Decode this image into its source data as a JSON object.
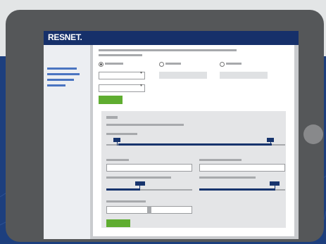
{
  "header": {
    "brand": "RESNET."
  },
  "colors": {
    "header_bg": "#16306a",
    "accent": "#5fad30",
    "slider": "#17346d",
    "nav_link": "#4a74c1",
    "tablet_frame": "#555759"
  },
  "sidebar": {
    "items": [
      "nav-item-1",
      "nav-item-2",
      "nav-item-3",
      "nav-item-4"
    ]
  },
  "form": {
    "radio_options": [
      "option-1",
      "option-2",
      "option-3"
    ],
    "selected_radio": 0,
    "sliders": [
      {
        "name": "range-slider-1",
        "min_fraction": 0.0,
        "max_fraction": 1.0
      },
      {
        "name": "slider-2",
        "value_fraction": 0.4
      },
      {
        "name": "slider-3",
        "value_fraction": 0.98
      }
    ]
  }
}
